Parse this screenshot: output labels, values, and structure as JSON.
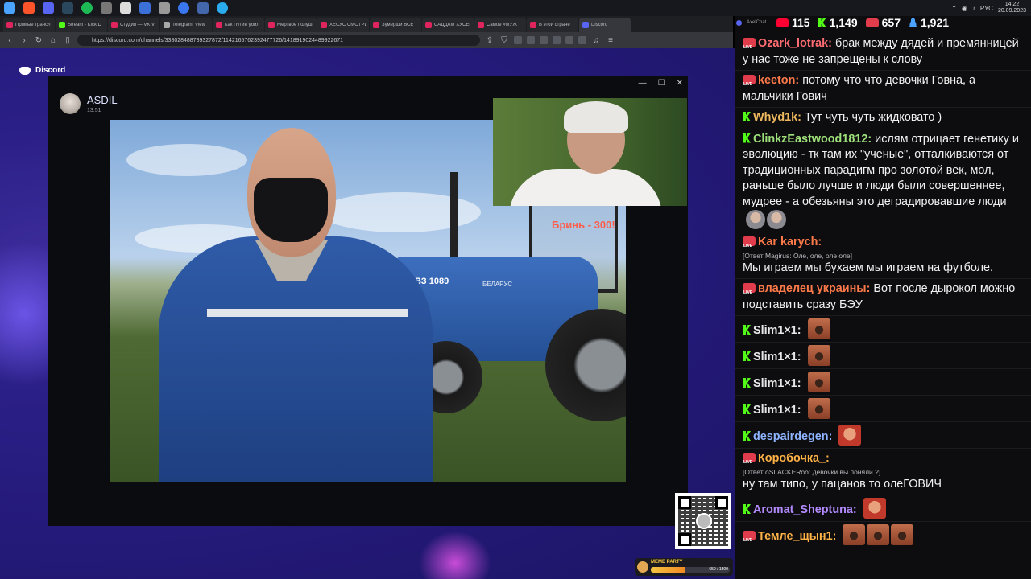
{
  "taskbar": {
    "clock_time": "14:22",
    "clock_date": "20.09.2023",
    "lang": "РУС",
    "icons": [
      "windows-icon",
      "brave-icon",
      "discord-icon",
      "steam-icon",
      "spotify-icon",
      "app-icon",
      "xsplit-icon",
      "obs-icon",
      "settings-icon",
      "signal-icon",
      "share-icon",
      "telegram-icon"
    ]
  },
  "browser": {
    "tabs": [
      {
        "label": "Прямые трансл",
        "color": "#e0245e"
      },
      {
        "label": "Stream - Kick D",
        "color": "#53fc18"
      },
      {
        "label": "Студия — VK V",
        "color": "#e0245e"
      },
      {
        "label": "Telegram: View",
        "color": "#aaaaaa"
      },
      {
        "label": "Как Путин убил",
        "color": "#e0245e"
      },
      {
        "label": "Мертвое полушарие",
        "color": "#e0245e"
      },
      {
        "label": "ХЕСУС СМОТРИТ",
        "color": "#e0245e"
      },
      {
        "label": "Зумерши ВСЁ",
        "color": "#e0245e"
      },
      {
        "label": "САДДАМ ХУСЕЙН",
        "color": "#e0245e"
      },
      {
        "label": "Самое #МУЖ",
        "color": "#e0245e"
      },
      {
        "label": "В этой стране",
        "color": "#e0245e"
      },
      {
        "label": "Discord",
        "color": "#5865f2"
      }
    ],
    "url": "https://discord.com/channels/338028488789327872/1142165762392477726/1418919024489922671"
  },
  "stage": {
    "discord_label": "Discord",
    "user_name": "ASDIL",
    "user_time": "13:51",
    "tractor_number": "ВЗ 1089",
    "tractor_brand": "БЕЛАРУС",
    "overlay_text": "Бринь - 300!"
  },
  "meme_party": {
    "label": "MEME PARTY",
    "value_text": "650 / 1500",
    "progress": 0.43
  },
  "chat": {
    "title": "AxelChat",
    "stats": {
      "youtube": "115",
      "kick": "1,149",
      "live": "657",
      "viewers": "1,921"
    },
    "colors": {
      "kick_green": "#53fc18",
      "live_red": "#e03c4c"
    },
    "messages": [
      {
        "badge": "live",
        "nick": "Ozark_lotrak:",
        "color": "#ff6d73",
        "text": "брак между дядей и премянницей у нас тоже не запрещены к слову"
      },
      {
        "badge": "live",
        "nick": "keeton:",
        "color": "#ff7a4a",
        "text": "потому что что девочки Говна, а мальчики Гович"
      },
      {
        "badge": "kick",
        "nick": "Whyd1k:",
        "color": "#eeb85e",
        "text": "Тут чуть чуть жидковато )"
      },
      {
        "badge": "kick",
        "nick": "ClinkzEastwood1812:",
        "color": "#9ee07a",
        "text": "ислям отрицает генетику и эволюцию - тк там их \"ученые\", отталкиваются от традиционных парадигм про золотой век, мол, раньше было лучше и люди были совершеннее, мудрее - а обезьяны это деградировавшие люди",
        "emotes": 2,
        "emote_style": "face"
      },
      {
        "badge": "live",
        "nick": "Kar karych:",
        "color": "#ff7a4a",
        "reply": "[Ответ Magirus: Оле, оле, оле оле]",
        "text": "Мы играем мы бухаем мы играем на футболе."
      },
      {
        "badge": "live",
        "nick": "владелец украины:",
        "color": "#ff7a4a",
        "text": "Вот после дырокол можно подставить сразу БЭУ"
      },
      {
        "badge": "kick",
        "nick": "Slim1×1:",
        "color": "#e7e7e7",
        "text": "",
        "emotes": 1
      },
      {
        "badge": "kick",
        "nick": "Slim1×1:",
        "color": "#e7e7e7",
        "text": "",
        "emotes": 1
      },
      {
        "badge": "kick",
        "nick": "Slim1×1:",
        "color": "#e7e7e7",
        "text": "",
        "emotes": 1
      },
      {
        "badge": "kick",
        "nick": "Slim1×1:",
        "color": "#e7e7e7",
        "text": "",
        "emotes": 1
      },
      {
        "badge": "kick",
        "nick": "despairdegen:",
        "color": "#8eb4ff",
        "text": "",
        "emotes": 1,
        "emote_style": "red"
      },
      {
        "badge": "live",
        "nick": "Коробочка_:",
        "color": "#ffb347",
        "reply": "[Ответ oSLACKERoo: девочки вы поняли ?]",
        "text": "ну там типо, у пацанов то олеГОВИЧ"
      },
      {
        "badge": "kick",
        "nick": "Aromat_Sheptuna:",
        "color": "#b38bff",
        "text": "",
        "emotes": 1,
        "emote_style": "red"
      },
      {
        "badge": "live",
        "nick": "Темле_щын1:",
        "color": "#ffb347",
        "text": "",
        "emotes": 3
      }
    ]
  }
}
